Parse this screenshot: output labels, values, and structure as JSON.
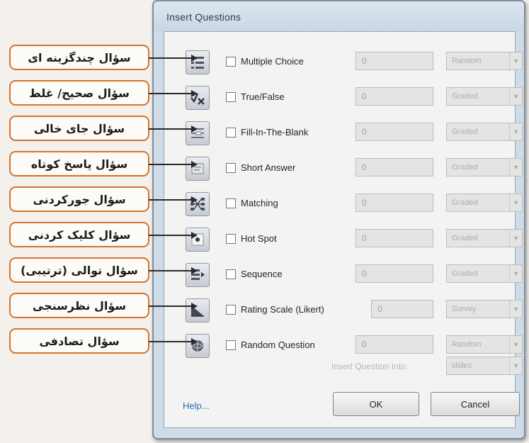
{
  "dialog": {
    "title": "Insert Questions",
    "questions": [
      {
        "label": "Multiple Choice",
        "count": "0",
        "dropdown": "Random",
        "icon": "multiple-choice-icon"
      },
      {
        "label": "True/False",
        "count": "0",
        "dropdown": "Graded",
        "icon": "true-false-icon"
      },
      {
        "label": "Fill-In-The-Blank",
        "count": "0",
        "dropdown": "Graded",
        "icon": "fill-in-blank-icon"
      },
      {
        "label": "Short Answer",
        "count": "0",
        "dropdown": "Graded",
        "icon": "short-answer-icon"
      },
      {
        "label": "Matching",
        "count": "0",
        "dropdown": "Graded",
        "icon": "matching-icon"
      },
      {
        "label": "Hot Spot",
        "count": "0",
        "dropdown": "Graded",
        "icon": "hot-spot-icon"
      },
      {
        "label": "Sequence",
        "count": "0",
        "dropdown": "Graded",
        "icon": "sequence-icon"
      },
      {
        "label": "Rating Scale (Likert)",
        "count": "0",
        "dropdown": "Survey",
        "icon": "rating-scale-icon"
      },
      {
        "label": "Random Question",
        "count": "0",
        "dropdown": "Random",
        "icon": "random-question-icon"
      }
    ],
    "insert_label": "Insert Question Into:",
    "insert_value": "slides",
    "help_label": "Help...",
    "ok_label": "OK",
    "cancel_label": "Cancel"
  },
  "callouts": [
    "سؤال چندگزینه ای",
    "سؤال صحیح/ غلط",
    "سؤال جای خالی",
    "سؤال پاسخ کوتاه",
    "سؤال جورکردنی",
    "سؤال کلیک کردنی",
    "سؤال توالی (ترتیبی)",
    "سؤال نظرسنجی",
    "سؤال تصادفی"
  ],
  "colors": {
    "callout_border": "#d4742c",
    "window_frame": "#cfdbe7",
    "link": "#2e6db5"
  }
}
